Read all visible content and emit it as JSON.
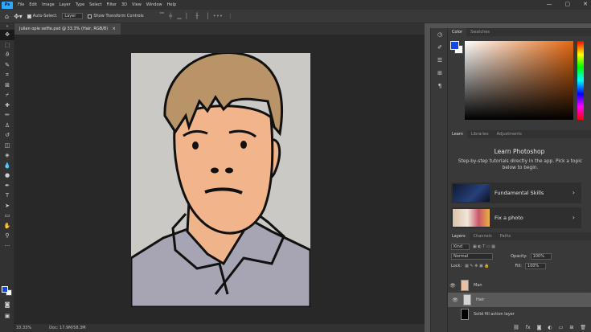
{
  "app": {
    "logo": "Ps",
    "menu": [
      "File",
      "Edit",
      "Image",
      "Layer",
      "Type",
      "Select",
      "Filter",
      "3D",
      "View",
      "Window",
      "Help"
    ],
    "window_buttons": [
      "—",
      "▢",
      "✕"
    ]
  },
  "options": {
    "auto_select_label": "Auto-Select:",
    "auto_select_target": "Layer",
    "transform_label": "Show Transform Controls"
  },
  "document": {
    "tab_title": "Julian opie selfie.psd @ 33.3% (Hair, RGB/8)",
    "tab_close": "×"
  },
  "status": {
    "zoom": "33.33%",
    "doc_info": "Doc: 17.9M/58.3M"
  },
  "color_panel": {
    "tabs": [
      "Color",
      "Swatches"
    ],
    "foreground_color": "#1447e6",
    "background_color": "#ffffff"
  },
  "learn_panel": {
    "tabs": [
      "Learn",
      "Libraries",
      "Adjustments"
    ],
    "title": "Learn Photoshop",
    "subtitle": "Step-by-step tutorials directly in the app. Pick a topic below to begin.",
    "cards": [
      {
        "label": "Fundamental Skills"
      },
      {
        "label": "Fix a photo"
      }
    ]
  },
  "layers_panel": {
    "tabs": [
      "Layers",
      "Channels",
      "Paths"
    ],
    "filter": "Kind",
    "blend_mode": "Normal",
    "opacity_label": "Opacity:",
    "opacity_value": "100%",
    "lock_label": "Lock:",
    "fill_label": "Fill:",
    "fill_value": "100%",
    "layers": [
      {
        "name": "Man",
        "visible": true,
        "selected": false
      },
      {
        "name": "Hair",
        "visible": true,
        "selected": true
      },
      {
        "name": "Solid fill action layer",
        "visible": false,
        "selected": false
      }
    ]
  },
  "accent": "#31a8ff"
}
